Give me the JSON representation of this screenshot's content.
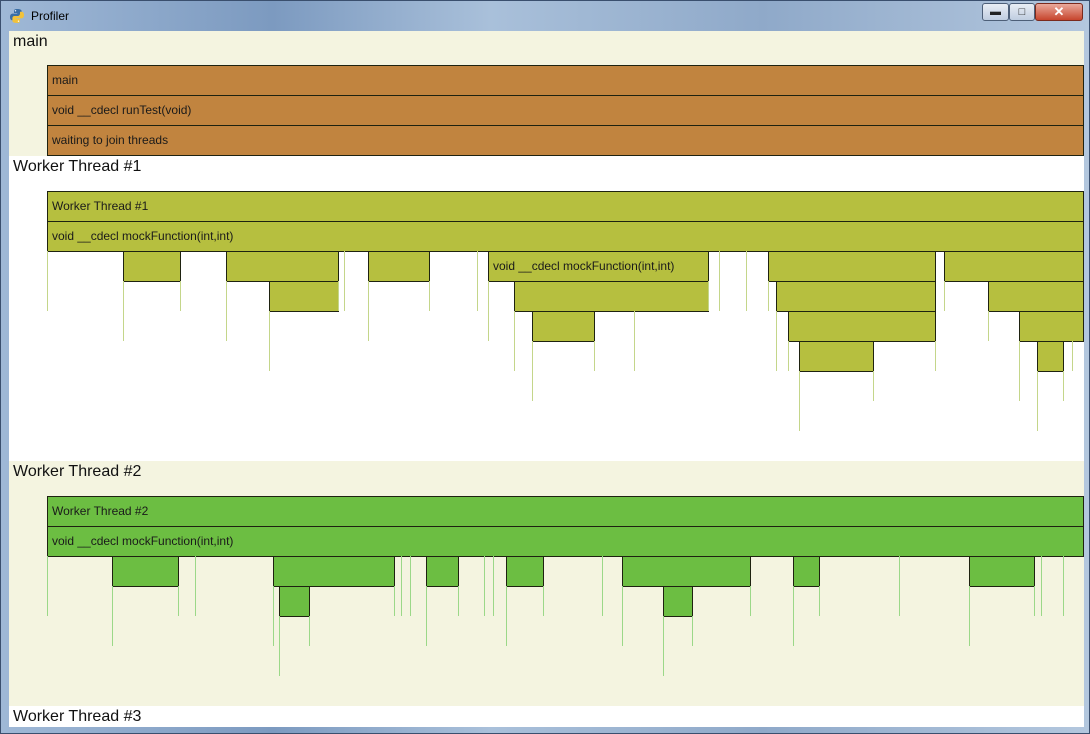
{
  "window": {
    "title": "Profiler",
    "app_icon": "python-icon"
  },
  "controls": {
    "minimize": "minimize-icon",
    "maximize": "maximize-icon",
    "close": "close-icon"
  },
  "colors": {
    "main_bar": "#c1843f",
    "worker1_bar": "#b6bf3f",
    "worker2_bar": "#6cbe42",
    "main_bg": "#f4f4e0",
    "worker1_bg": "#ffffff",
    "worker2_bg": "#f4f4e0",
    "worker3_bg": "#ffffff",
    "worker1_tick": "#c4d68a",
    "worker2_tick": "#9bd888"
  },
  "sections": [
    {
      "title": "main",
      "bars": [
        {
          "label": "main"
        },
        {
          "label": "void __cdecl runTest(void)"
        },
        {
          "label": "waiting to join threads"
        }
      ]
    },
    {
      "title": "Worker Thread #1",
      "bars": [
        {
          "label": "Worker Thread #1"
        },
        {
          "label": "void __cdecl mockFunction(int,int)"
        },
        {
          "label": "void __cdecl mockFunction(int,int)"
        }
      ]
    },
    {
      "title": "Worker Thread #2",
      "bars": [
        {
          "label": "Worker Thread #2"
        },
        {
          "label": "void __cdecl mockFunction(int,int)"
        }
      ]
    },
    {
      "title": "Worker Thread #3",
      "bars": []
    }
  ]
}
